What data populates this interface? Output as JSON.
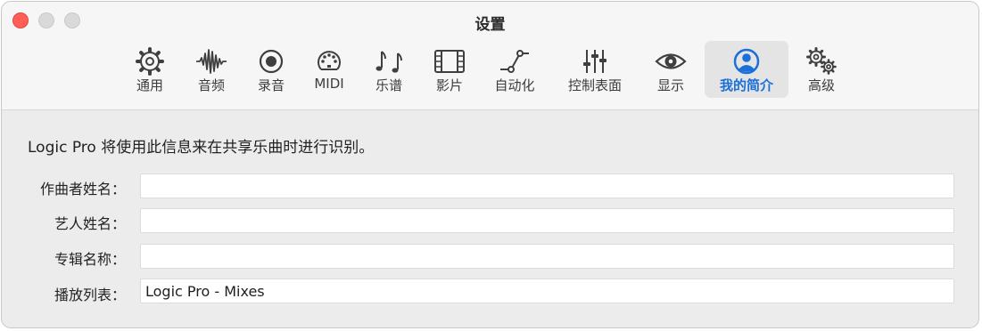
{
  "window": {
    "title": "设置"
  },
  "tabs": [
    {
      "label": "通用",
      "icon": "gear-icon"
    },
    {
      "label": "音频",
      "icon": "waveform-icon"
    },
    {
      "label": "录音",
      "icon": "record-icon"
    },
    {
      "label": "MIDI",
      "icon": "midi-connector-icon"
    },
    {
      "label": "乐谱",
      "icon": "music-notes-icon"
    },
    {
      "label": "影片",
      "icon": "film-icon"
    },
    {
      "label": "自动化",
      "icon": "automation-icon"
    },
    {
      "label": "控制表面",
      "icon": "sliders-icon"
    },
    {
      "label": "显示",
      "icon": "eye-icon"
    },
    {
      "label": "我的简介",
      "icon": "person-circle-icon",
      "selected": true
    },
    {
      "label": "高级",
      "icon": "gears-icon"
    }
  ],
  "main": {
    "description": "Logic Pro 将使用此信息来在共享乐曲时进行识别。",
    "fields": [
      {
        "label": "作曲者姓名：",
        "value": ""
      },
      {
        "label": "艺人姓名：",
        "value": ""
      },
      {
        "label": "专辑名称：",
        "value": ""
      },
      {
        "label": "播放列表：",
        "value": "Logic Pro - Mixes"
      }
    ]
  },
  "colors": {
    "accent": "#1a6fd9",
    "close": "#ff5f57",
    "inactive_button": "#d9d9d9"
  }
}
